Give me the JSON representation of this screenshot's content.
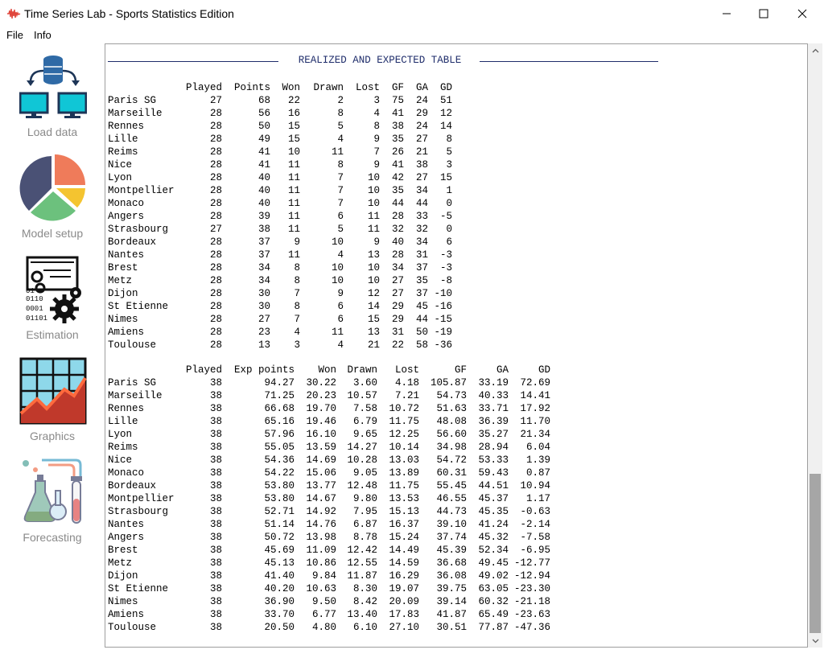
{
  "window": {
    "title": "Time Series Lab - Sports Statistics Edition"
  },
  "menu": {
    "file": "File",
    "info": "Info"
  },
  "sidebar": {
    "items": [
      {
        "label": "Load data",
        "icon": "database-network-icon"
      },
      {
        "label": "Model setup",
        "icon": "pie-chart-icon"
      },
      {
        "label": "Estimation",
        "icon": "binary-gears-icon"
      },
      {
        "label": "Graphics",
        "icon": "chart-grid-icon"
      },
      {
        "label": "Forecasting",
        "icon": "lab-flask-icon"
      }
    ]
  },
  "section_title": "REALIZED AND EXPECTED TABLE",
  "realized": {
    "headers": [
      "",
      "Played",
      "Points",
      "Won",
      "Drawn",
      "Lost",
      "GF",
      "GA",
      "GD"
    ],
    "rows": [
      [
        "Paris SG",
        "27",
        "68",
        "22",
        "2",
        "3",
        "75",
        "24",
        "51"
      ],
      [
        "Marseille",
        "28",
        "56",
        "16",
        "8",
        "4",
        "41",
        "29",
        "12"
      ],
      [
        "Rennes",
        "28",
        "50",
        "15",
        "5",
        "8",
        "38",
        "24",
        "14"
      ],
      [
        "Lille",
        "28",
        "49",
        "15",
        "4",
        "9",
        "35",
        "27",
        "8"
      ],
      [
        "Reims",
        "28",
        "41",
        "10",
        "11",
        "7",
        "26",
        "21",
        "5"
      ],
      [
        "Nice",
        "28",
        "41",
        "11",
        "8",
        "9",
        "41",
        "38",
        "3"
      ],
      [
        "Lyon",
        "28",
        "40",
        "11",
        "7",
        "10",
        "42",
        "27",
        "15"
      ],
      [
        "Montpellier",
        "28",
        "40",
        "11",
        "7",
        "10",
        "35",
        "34",
        "1"
      ],
      [
        "Monaco",
        "28",
        "40",
        "11",
        "7",
        "10",
        "44",
        "44",
        "0"
      ],
      [
        "Angers",
        "28",
        "39",
        "11",
        "6",
        "11",
        "28",
        "33",
        "-5"
      ],
      [
        "Strasbourg",
        "27",
        "38",
        "11",
        "5",
        "11",
        "32",
        "32",
        "0"
      ],
      [
        "Bordeaux",
        "28",
        "37",
        "9",
        "10",
        "9",
        "40",
        "34",
        "6"
      ],
      [
        "Nantes",
        "28",
        "37",
        "11",
        "4",
        "13",
        "28",
        "31",
        "-3"
      ],
      [
        "Brest",
        "28",
        "34",
        "8",
        "10",
        "10",
        "34",
        "37",
        "-3"
      ],
      [
        "Metz",
        "28",
        "34",
        "8",
        "10",
        "10",
        "27",
        "35",
        "-8"
      ],
      [
        "Dijon",
        "28",
        "30",
        "7",
        "9",
        "12",
        "27",
        "37",
        "-10"
      ],
      [
        "St Etienne",
        "28",
        "30",
        "8",
        "6",
        "14",
        "29",
        "45",
        "-16"
      ],
      [
        "Nimes",
        "28",
        "27",
        "7",
        "6",
        "15",
        "29",
        "44",
        "-15"
      ],
      [
        "Amiens",
        "28",
        "23",
        "4",
        "11",
        "13",
        "31",
        "50",
        "-19"
      ],
      [
        "Toulouse",
        "28",
        "13",
        "3",
        "4",
        "21",
        "22",
        "58",
        "-36"
      ]
    ]
  },
  "expected": {
    "headers": [
      "",
      "Played",
      "Exp points",
      "Won",
      "Drawn",
      "Lost",
      "GF",
      "GA",
      "GD"
    ],
    "rows": [
      [
        "Paris SG",
        "38",
        "94.27",
        "30.22",
        "3.60",
        "4.18",
        "105.87",
        "33.19",
        "72.69"
      ],
      [
        "Marseille",
        "38",
        "71.25",
        "20.23",
        "10.57",
        "7.21",
        "54.73",
        "40.33",
        "14.41"
      ],
      [
        "Rennes",
        "38",
        "66.68",
        "19.70",
        "7.58",
        "10.72",
        "51.63",
        "33.71",
        "17.92"
      ],
      [
        "Lille",
        "38",
        "65.16",
        "19.46",
        "6.79",
        "11.75",
        "48.08",
        "36.39",
        "11.70"
      ],
      [
        "Lyon",
        "38",
        "57.96",
        "16.10",
        "9.65",
        "12.25",
        "56.60",
        "35.27",
        "21.34"
      ],
      [
        "Reims",
        "38",
        "55.05",
        "13.59",
        "14.27",
        "10.14",
        "34.98",
        "28.94",
        "6.04"
      ],
      [
        "Nice",
        "38",
        "54.36",
        "14.69",
        "10.28",
        "13.03",
        "54.72",
        "53.33",
        "1.39"
      ],
      [
        "Monaco",
        "38",
        "54.22",
        "15.06",
        "9.05",
        "13.89",
        "60.31",
        "59.43",
        "0.87"
      ],
      [
        "Bordeaux",
        "38",
        "53.80",
        "13.77",
        "12.48",
        "11.75",
        "55.45",
        "44.51",
        "10.94"
      ],
      [
        "Montpellier",
        "38",
        "53.80",
        "14.67",
        "9.80",
        "13.53",
        "46.55",
        "45.37",
        "1.17"
      ],
      [
        "Strasbourg",
        "38",
        "52.71",
        "14.92",
        "7.95",
        "15.13",
        "44.73",
        "45.35",
        "-0.63"
      ],
      [
        "Nantes",
        "38",
        "51.14",
        "14.76",
        "6.87",
        "16.37",
        "39.10",
        "41.24",
        "-2.14"
      ],
      [
        "Angers",
        "38",
        "50.72",
        "13.98",
        "8.78",
        "15.24",
        "37.74",
        "45.32",
        "-7.58"
      ],
      [
        "Brest",
        "38",
        "45.69",
        "11.09",
        "12.42",
        "14.49",
        "45.39",
        "52.34",
        "-6.95"
      ],
      [
        "Metz",
        "38",
        "45.13",
        "10.86",
        "12.55",
        "14.59",
        "36.68",
        "49.45",
        "-12.77"
      ],
      [
        "Dijon",
        "38",
        "41.40",
        "9.84",
        "11.87",
        "16.29",
        "36.08",
        "49.02",
        "-12.94"
      ],
      [
        "St Etienne",
        "38",
        "40.20",
        "10.63",
        "8.30",
        "19.07",
        "39.75",
        "63.05",
        "-23.30"
      ],
      [
        "Nimes",
        "38",
        "36.90",
        "9.50",
        "8.42",
        "20.09",
        "39.14",
        "60.32",
        "-21.18"
      ],
      [
        "Amiens",
        "38",
        "33.70",
        "6.77",
        "13.40",
        "17.83",
        "41.87",
        "65.49",
        "-23.63"
      ],
      [
        "Toulouse",
        "38",
        "20.50",
        "4.80",
        "6.10",
        "27.10",
        "30.51",
        "77.87",
        "-47.36"
      ]
    ]
  },
  "colors": {
    "title_navy": "#1f2d6b",
    "sidebar_label": "#8a8a8a"
  }
}
